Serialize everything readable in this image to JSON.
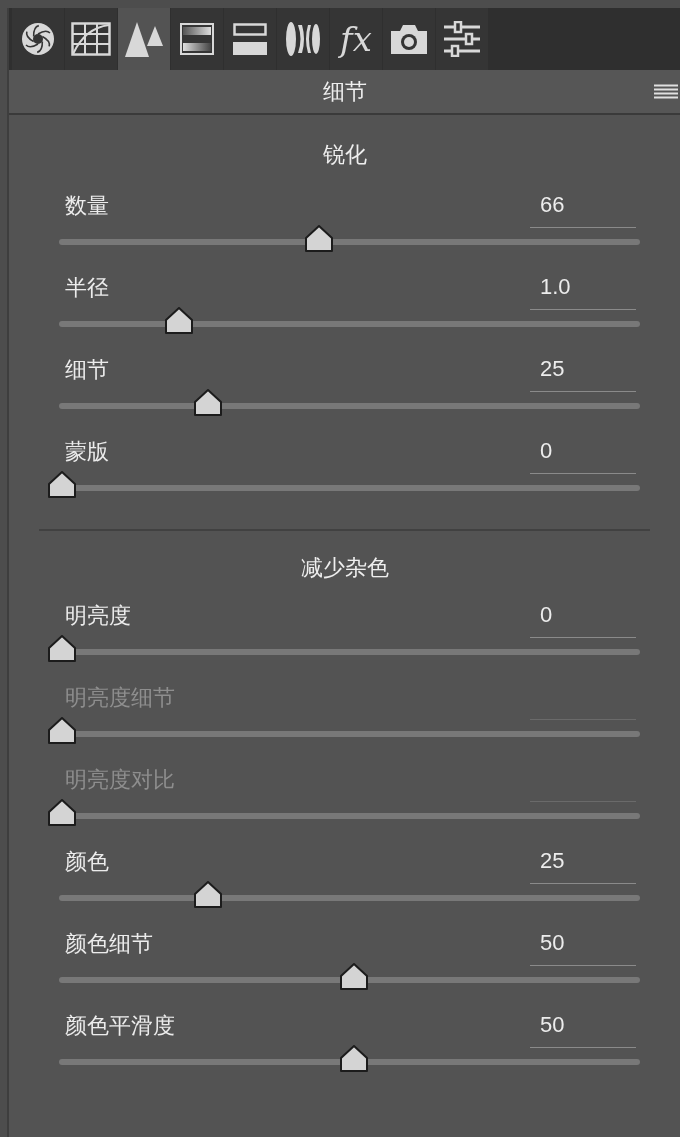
{
  "tabs": [
    {
      "kind": "aperture",
      "selected": false
    },
    {
      "kind": "curve",
      "selected": false
    },
    {
      "kind": "peaks",
      "selected": true
    },
    {
      "kind": "gradient",
      "selected": false
    },
    {
      "kind": "split",
      "selected": false
    },
    {
      "kind": "lens",
      "selected": false
    },
    {
      "kind": "text",
      "label": "fx",
      "selected": false
    },
    {
      "kind": "camera",
      "selected": false
    },
    {
      "kind": "sliders",
      "selected": false
    }
  ],
  "panel": {
    "title": "细节"
  },
  "sections": [
    {
      "title": "锐化",
      "rows": [
        {
          "label": "数量",
          "value": "66",
          "level": 0.44,
          "disabled": false
        },
        {
          "label": "半径",
          "value": "1.0",
          "level": 0.2,
          "disabled": false
        },
        {
          "label": "细节",
          "value": "25",
          "level": 0.25,
          "disabled": false
        },
        {
          "label": "蒙版",
          "value": "0",
          "level": 0,
          "disabled": false
        }
      ]
    },
    {
      "title": "减少杂色",
      "rows": [
        {
          "label": "明亮度",
          "value": "0",
          "level": 0,
          "disabled": false
        },
        {
          "label": "明亮度细节",
          "level": 0,
          "disabled": true
        },
        {
          "label": "明亮度对比",
          "level": 0,
          "disabled": true
        },
        {
          "label": "颜色",
          "value": "25",
          "level": 0.25,
          "disabled": false
        },
        {
          "label": "颜色细节",
          "value": "50",
          "level": 0.5,
          "disabled": false
        },
        {
          "label": "颜色平滑度",
          "value": "50",
          "level": 0.5,
          "disabled": false
        }
      ]
    }
  ]
}
